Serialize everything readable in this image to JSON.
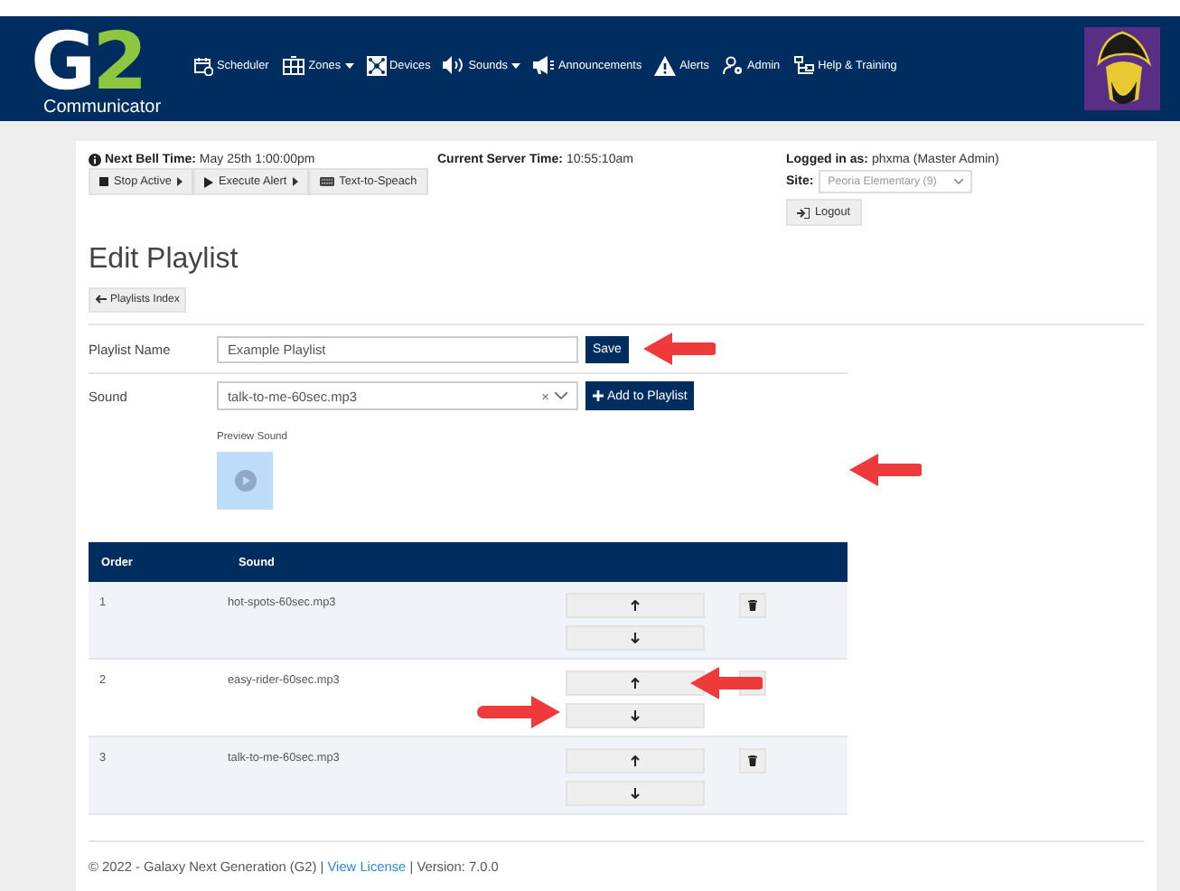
{
  "navbar": {
    "logo": {
      "letters": [
        {
          "text": "G",
          "color": "#ffffff"
        },
        {
          "text": "2",
          "color": "#8dc63f"
        }
      ],
      "subtitle": "Communicator"
    },
    "items": [
      {
        "kind": "scheduler",
        "label": "Scheduler",
        "dropdown": false
      },
      {
        "kind": "zones",
        "label": "Zones",
        "dropdown": true
      },
      {
        "kind": "devices",
        "label": "Devices",
        "dropdown": false
      },
      {
        "kind": "sounds",
        "label": "Sounds",
        "dropdown": true
      },
      {
        "kind": "announcements",
        "label": "Announcements",
        "dropdown": false
      },
      {
        "kind": "alerts",
        "label": "Alerts",
        "dropdown": false
      },
      {
        "kind": "admin",
        "label": "Admin",
        "dropdown": false
      },
      {
        "kind": "help",
        "label": "Help & Training",
        "dropdown": false
      }
    ]
  },
  "info_bar": {
    "next_bell": {
      "label": "Next Bell Time:",
      "value": "May 25th 1:00:00pm"
    },
    "actions": [
      {
        "kind": "stop",
        "label": "Stop Active",
        "dropdown": true
      },
      {
        "kind": "execute",
        "label": "Execute Alert",
        "dropdown": true
      },
      {
        "kind": "tts",
        "label": "Text-to-Speach",
        "dropdown": false
      }
    ],
    "server_time": {
      "label": "Current Server Time:",
      "value": "10:55:10am"
    },
    "logged_in": {
      "label": "Logged in as:",
      "value": "phxma (Master Admin)"
    },
    "site": {
      "label": "Site:",
      "value": "Peoria Elementary (9)"
    },
    "logout": "Logout"
  },
  "page": {
    "title": "Edit Playlist",
    "back_button": "Playlists Index"
  },
  "form": {
    "playlist_name": {
      "label": "Playlist Name",
      "value": "Example Playlist",
      "button": "Save",
      "pointer_arrow": true
    },
    "sound": {
      "label": "Sound",
      "value": "talk-to-me-60sec.mp3",
      "clear": "×",
      "button": "Add to Playlist"
    },
    "preview": {
      "label": "Preview Sound",
      "pointer_arrow": true
    }
  },
  "table": {
    "columns": [
      "Order",
      "Sound"
    ],
    "rows": [
      {
        "order": "1",
        "sound": "hot-spots-60sec.mp3",
        "up_pointer": false,
        "down_pointer": false
      },
      {
        "order": "2",
        "sound": "easy-rider-60sec.mp3",
        "up_pointer": true,
        "down_pointer": true
      },
      {
        "order": "3",
        "sound": "talk-to-me-60sec.mp3",
        "up_pointer": false,
        "down_pointer": false
      }
    ]
  },
  "footer": {
    "text_before": "© 2022 - Galaxy Next Generation (G2) |",
    "link": "View License",
    "text_after": "| Version: 7.0.0"
  }
}
